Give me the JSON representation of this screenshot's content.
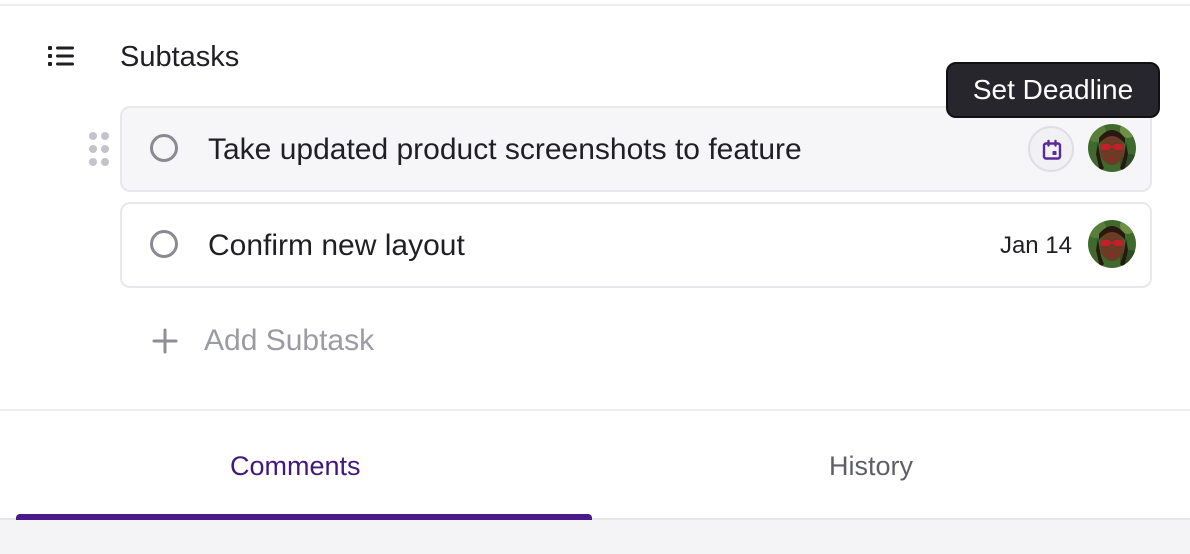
{
  "section": {
    "title": "Subtasks",
    "icon": "list-icon"
  },
  "subtasks": [
    {
      "title": "Take updated product screenshots to feature",
      "due": "",
      "deadline_icon": "calendar-icon"
    },
    {
      "title": "Confirm new layout",
      "due": "Jan 14"
    }
  ],
  "tooltip": {
    "text": "Set Deadline"
  },
  "add_subtask": {
    "label": "Add Subtask",
    "icon": "plus-icon"
  },
  "tabs": [
    {
      "label": "Comments",
      "active": true
    },
    {
      "label": "History",
      "active": false
    }
  ],
  "colors": {
    "accent": "#4a1a8a",
    "active_tab_text": "#42197a",
    "tooltip_bg": "#26262c",
    "placeholder_text": "#9b9ba3",
    "calendar_icon": "#5b2a9a"
  }
}
